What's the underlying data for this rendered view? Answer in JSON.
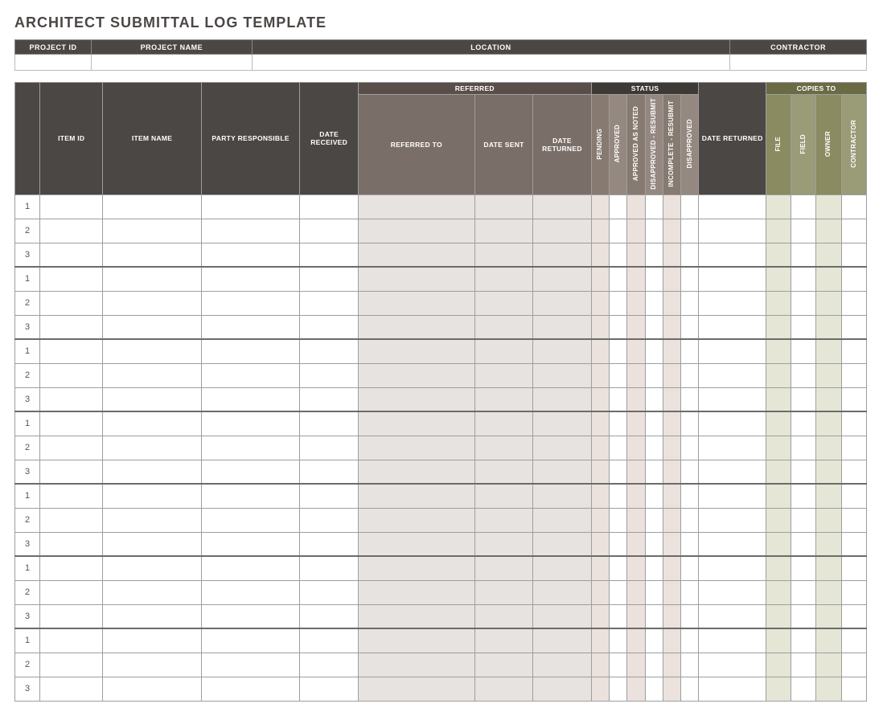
{
  "title": "ARCHITECT SUBMITTAL LOG TEMPLATE",
  "project_info": {
    "headers": {
      "project_id": "PROJECT ID",
      "project_name": "PROJECT NAME",
      "location": "LOCATION",
      "contractor": "CONTRACTOR"
    },
    "values": {
      "project_id": "",
      "project_name": "",
      "location": "",
      "contractor": ""
    }
  },
  "columns": {
    "item_id": "ITEM ID",
    "item_name": "ITEM NAME",
    "party_responsible": "PARTY RESPONSIBLE",
    "date_received": "DATE RECEIVED",
    "referred_group": "REFERRED",
    "referred_to": "REFERRED TO",
    "date_sent": "DATE SENT",
    "date_returned_ref": "DATE RETURNED",
    "status_group": "STATUS",
    "status": {
      "pending": "PENDING",
      "approved": "APPROVED",
      "approved_as_noted": "APPROVED AS NOTED",
      "disapproved_resubmit": "DISAPPROVED - RESUBMIT",
      "incomplete_resubmit": "INCOMPLETE - RESUBMIT",
      "disapproved": "DISAPPROVED"
    },
    "date_returned": "DATE RETURNED",
    "copies_group": "COPIES TO",
    "copies": {
      "file": "FILE",
      "field": "FIELD",
      "owner": "OWNER",
      "contractor": "CONTRACTOR"
    }
  },
  "groups": [
    {
      "rows": [
        "1",
        "2",
        "3"
      ]
    },
    {
      "rows": [
        "1",
        "2",
        "3"
      ]
    },
    {
      "rows": [
        "1",
        "2",
        "3"
      ]
    },
    {
      "rows": [
        "1",
        "2",
        "3"
      ]
    },
    {
      "rows": [
        "1",
        "2",
        "3"
      ]
    },
    {
      "rows": [
        "1",
        "2",
        "3"
      ]
    },
    {
      "rows": [
        "1",
        "2",
        "3"
      ]
    }
  ]
}
